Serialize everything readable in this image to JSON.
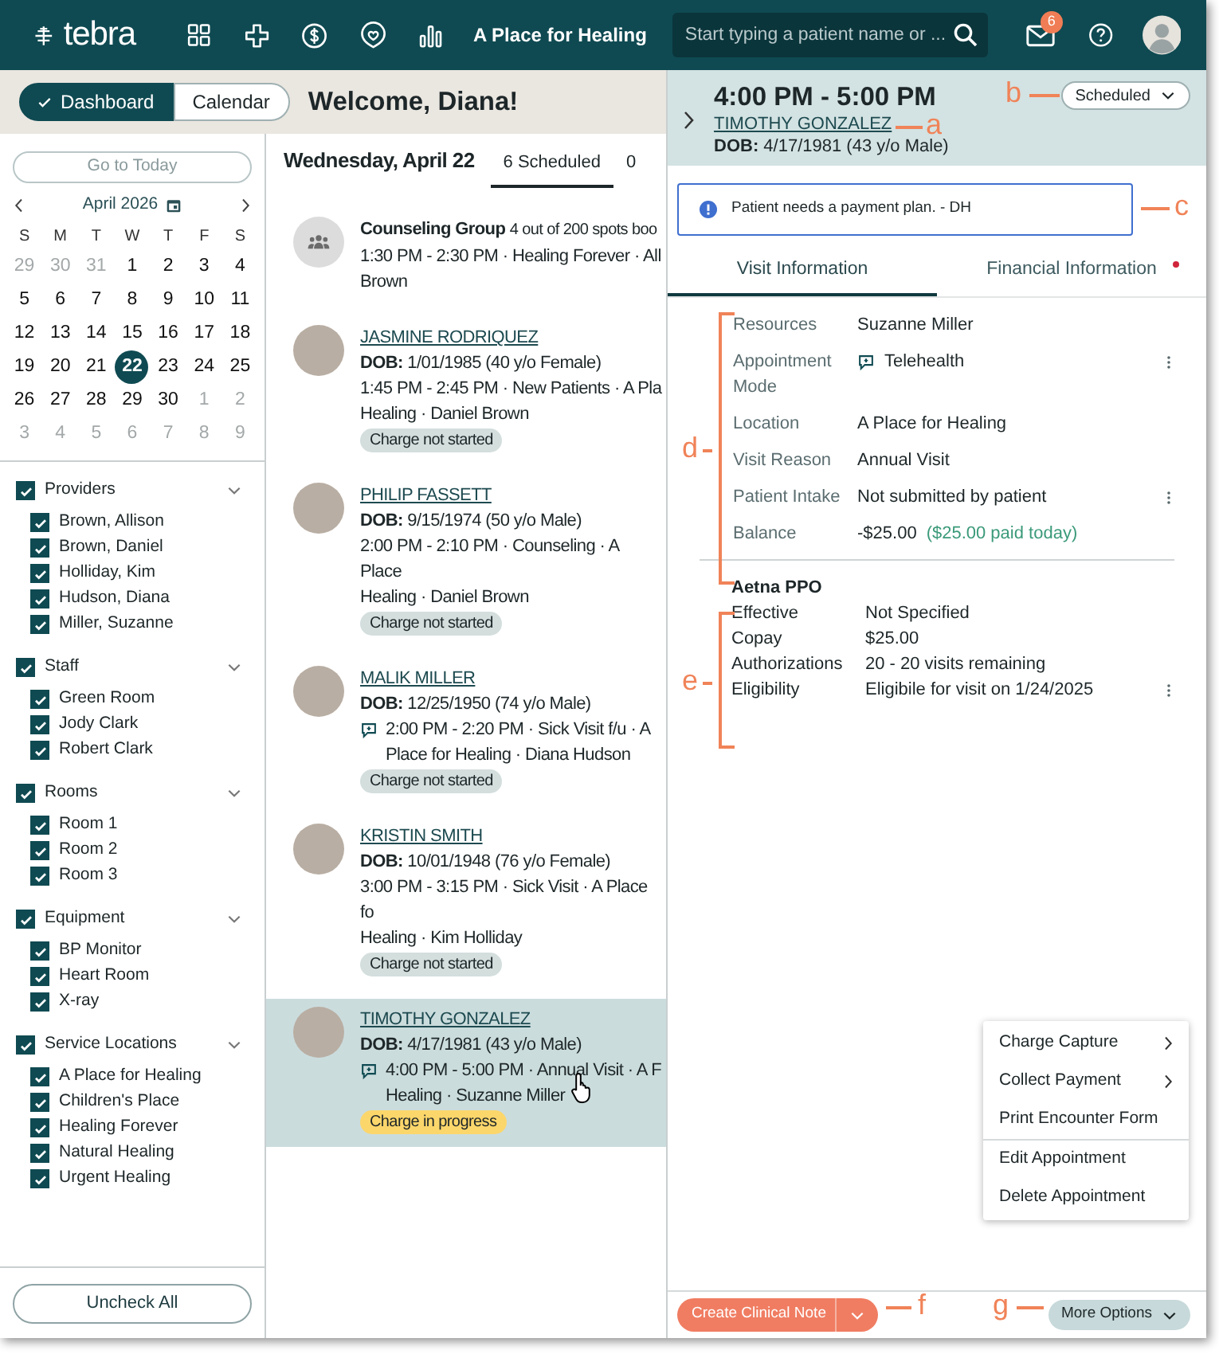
{
  "top_bar": {
    "logo": "tebra",
    "practice": "A Place for Healing",
    "search": {
      "placeholder": "Start typing a patient name or ..."
    },
    "notification_count": "6"
  },
  "view_switch": [
    {
      "label": "Dashboard",
      "selected": true
    },
    {
      "label": "Calendar",
      "selected": false
    }
  ],
  "welcome": "Welcome, Diana!",
  "sidebar": {
    "go_to_today": {
      "label": "Go to Today",
      "disabled": true
    },
    "month": "April 2026",
    "weekdays": [
      "S",
      "M",
      "T",
      "W",
      "T",
      "F",
      "S"
    ],
    "days": [
      {
        "label": "29",
        "muted": true,
        "selected": false
      },
      {
        "label": "30",
        "muted": true,
        "selected": false
      },
      {
        "label": "31",
        "muted": true,
        "selected": false
      },
      {
        "label": "1",
        "muted": false,
        "selected": false
      },
      {
        "label": "2",
        "muted": false,
        "selected": false
      },
      {
        "label": "3",
        "muted": false,
        "selected": false
      },
      {
        "label": "4",
        "muted": false,
        "selected": false
      },
      {
        "label": "5",
        "muted": false,
        "selected": false
      },
      {
        "label": "6",
        "muted": false,
        "selected": false
      },
      {
        "label": "7",
        "muted": false,
        "selected": false
      },
      {
        "label": "8",
        "muted": false,
        "selected": false
      },
      {
        "label": "9",
        "muted": false,
        "selected": false
      },
      {
        "label": "10",
        "muted": false,
        "selected": false
      },
      {
        "label": "11",
        "muted": false,
        "selected": false
      },
      {
        "label": "12",
        "muted": false,
        "selected": false
      },
      {
        "label": "13",
        "muted": false,
        "selected": false
      },
      {
        "label": "14",
        "muted": false,
        "selected": false
      },
      {
        "label": "15",
        "muted": false,
        "selected": false
      },
      {
        "label": "16",
        "muted": false,
        "selected": false
      },
      {
        "label": "17",
        "muted": false,
        "selected": false
      },
      {
        "label": "18",
        "muted": false,
        "selected": false
      },
      {
        "label": "19",
        "muted": false,
        "selected": false
      },
      {
        "label": "20",
        "muted": false,
        "selected": false
      },
      {
        "label": "21",
        "muted": false,
        "selected": false
      },
      {
        "label": "22",
        "muted": false,
        "selected": true
      },
      {
        "label": "23",
        "muted": false,
        "selected": false
      },
      {
        "label": "24",
        "muted": false,
        "selected": false
      },
      {
        "label": "25",
        "muted": false,
        "selected": false
      },
      {
        "label": "26",
        "muted": false,
        "selected": false
      },
      {
        "label": "27",
        "muted": false,
        "selected": false
      },
      {
        "label": "28",
        "muted": false,
        "selected": false
      },
      {
        "label": "29",
        "muted": false,
        "selected": false
      },
      {
        "label": "30",
        "muted": false,
        "selected": false
      },
      {
        "label": "1",
        "muted": true,
        "selected": false
      },
      {
        "label": "2",
        "muted": true,
        "selected": false
      },
      {
        "label": "3",
        "muted": true,
        "selected": false
      },
      {
        "label": "4",
        "muted": true,
        "selected": false
      },
      {
        "label": "5",
        "muted": true,
        "selected": false
      },
      {
        "label": "6",
        "muted": true,
        "selected": false
      },
      {
        "label": "7",
        "muted": true,
        "selected": false
      },
      {
        "label": "8",
        "muted": true,
        "selected": false
      },
      {
        "label": "9",
        "muted": true,
        "selected": false
      }
    ],
    "groups": [
      {
        "label": "Providers",
        "checked": true,
        "items": [
          {
            "label": "Brown, Allison",
            "checked": true
          },
          {
            "label": "Brown, Daniel",
            "checked": true
          },
          {
            "label": "Holliday, Kim",
            "checked": true
          },
          {
            "label": "Hudson, Diana",
            "checked": true
          },
          {
            "label": "Miller, Suzanne",
            "checked": true
          }
        ]
      },
      {
        "label": "Staff",
        "checked": true,
        "items": [
          {
            "label": "Green Room",
            "checked": true
          },
          {
            "label": "Jody Clark",
            "checked": true
          },
          {
            "label": "Robert Clark",
            "checked": true
          }
        ]
      },
      {
        "label": "Rooms",
        "checked": true,
        "items": [
          {
            "label": "Room 1",
            "checked": true
          },
          {
            "label": "Room 2",
            "checked": true
          },
          {
            "label": "Room 3",
            "checked": true
          }
        ]
      },
      {
        "label": "Equipment",
        "checked": true,
        "items": [
          {
            "label": "BP Monitor",
            "checked": true
          },
          {
            "label": "Heart Room",
            "checked": true
          },
          {
            "label": "X-ray",
            "checked": true
          }
        ]
      },
      {
        "label": "Service Locations",
        "checked": true,
        "items": [
          {
            "label": "A Place for Healing",
            "checked": true
          },
          {
            "label": "Children's Place",
            "checked": true
          },
          {
            "label": "Healing Forever",
            "checked": true
          },
          {
            "label": "Natural Healing",
            "checked": true
          },
          {
            "label": "Urgent Healing",
            "checked": true
          }
        ]
      }
    ],
    "uncheck_all": "Uncheck All"
  },
  "schedule": {
    "date": "Wednesday, April 22",
    "tabs": [
      {
        "label": "6 Scheduled",
        "selected": true
      },
      {
        "label": "0",
        "selected": false
      }
    ],
    "appointments": [
      {
        "kind": "group",
        "title": "Counseling Group",
        "spots": "4 out of 200 spots boo",
        "lines": [
          "1:30 PM - 2:30 PM · Healing Forever · All",
          "Brown"
        ],
        "selected": false
      },
      {
        "kind": "patient",
        "name": "JASMINE RODRIQUEZ",
        "dob": "**DOB:** 1/01/1985 (40 y/o Female)",
        "telehealth": false,
        "lines": [
          "1:45 PM - 2:45 PM · New Patients · A Pla",
          "Healing · Daniel Brown"
        ],
        "charge": {
          "label": "Charge not started",
          "kind": "not_started"
        },
        "selected": false
      },
      {
        "kind": "patient",
        "name": "PHILIP FASSETT",
        "dob": "**DOB:** 9/15/1974 (50 y/o Male)",
        "telehealth": false,
        "lines": [
          "2:00 PM - 2:10 PM · Counseling · A Place",
          "Healing · Daniel Brown"
        ],
        "charge": {
          "label": "Charge not started",
          "kind": "not_started"
        },
        "selected": false
      },
      {
        "kind": "patient",
        "name": "MALIK MILLER",
        "dob": "**DOB:** 12/25/1950 (74 y/o Male)",
        "telehealth": true,
        "lines": [
          "2:00 PM - 2:20 PM · Sick Visit f/u · A",
          "Place for Healing · Diana Hudson"
        ],
        "charge": {
          "label": "Charge not started",
          "kind": "not_started"
        },
        "selected": false
      },
      {
        "kind": "patient",
        "name": "KRISTIN SMITH",
        "dob": "**DOB:** 10/01/1948 (76 y/o Female)",
        "telehealth": false,
        "lines": [
          "3:00 PM - 3:15 PM · Sick Visit · A Place fo",
          "Healing · Kim Holliday"
        ],
        "charge": {
          "label": "Charge not started",
          "kind": "not_started"
        },
        "selected": false
      },
      {
        "kind": "patient",
        "name": "TIMOTHY GONZALEZ",
        "dob": "**DOB:** 4/17/1981 (43 y/o Male)",
        "telehealth": true,
        "lines": [
          "4:00 PM - 5:00 PM · Annual Visit · A F",
          "Healing · Suzanne Miller"
        ],
        "charge": {
          "label": "Charge in progress",
          "kind": "in_progress"
        },
        "selected": true
      }
    ]
  },
  "detail": {
    "time": "4:00 PM - 5:00 PM",
    "name": "TIMOTHY GONZALEZ",
    "dob": "**DOB:** 4/17/1981 (43 y/o Male)",
    "status": "Scheduled",
    "alert": "Patient needs a payment plan. - DH",
    "tabs": [
      {
        "label": "Visit Information",
        "selected": true,
        "alert_dot": false
      },
      {
        "label": "Financial Information",
        "selected": false,
        "alert_dot": true
      }
    ],
    "visit_rows": [
      {
        "label": "Resources",
        "value": "Suzanne Miller",
        "telehealth": false,
        "menu": false
      },
      {
        "label": "Appointment Mode",
        "value": "Telehealth",
        "telehealth": true,
        "menu": true
      },
      {
        "label": "Location",
        "value": "A Place for Healing",
        "telehealth": false,
        "menu": false
      },
      {
        "label": "Visit Reason",
        "value": "Annual Visit",
        "telehealth": false,
        "menu": false
      },
      {
        "label": "Patient Intake",
        "value": "Not submitted by patient",
        "telehealth": false,
        "menu": true
      },
      {
        "label": "Balance",
        "value": "-$25.00",
        "note": "($25.00 paid today)",
        "telehealth": false,
        "menu": false
      }
    ],
    "insurance": {
      "name": "Aetna PPO",
      "rows": [
        {
          "label": "Effective",
          "value": "Not Specified",
          "menu": false
        },
        {
          "label": "Copay",
          "value": "$25.00",
          "menu": false
        },
        {
          "label": "Authorizations",
          "value": "20 - 20 visits remaining",
          "menu": false
        },
        {
          "label": "Eligibility",
          "value": "Eligibile for visit on 1/24/2025",
          "menu": true
        }
      ]
    },
    "menu": {
      "sections": [
        {
          "items": [
            {
              "label": "Charge Capture",
              "submenu": true
            },
            {
              "label": "Collect Payment",
              "submenu": true
            },
            {
              "label": "Print Encounter Form",
              "submenu": false
            }
          ]
        },
        {
          "items": [
            {
              "label": "Edit Appointment",
              "submenu": false
            },
            {
              "label": "Delete Appointment",
              "submenu": false
            }
          ]
        }
      ]
    },
    "create_note": "Create Clinical Note",
    "more_options": "More Options"
  },
  "callouts": [
    {
      "letter": "a",
      "kind": "line"
    },
    {
      "letter": "b",
      "kind": "line"
    },
    {
      "letter": "c",
      "kind": "line"
    },
    {
      "letter": "d",
      "kind": "bracket"
    },
    {
      "letter": "e",
      "kind": "bracket"
    },
    {
      "letter": "f",
      "kind": "line"
    },
    {
      "letter": "g",
      "kind": "line"
    }
  ]
}
